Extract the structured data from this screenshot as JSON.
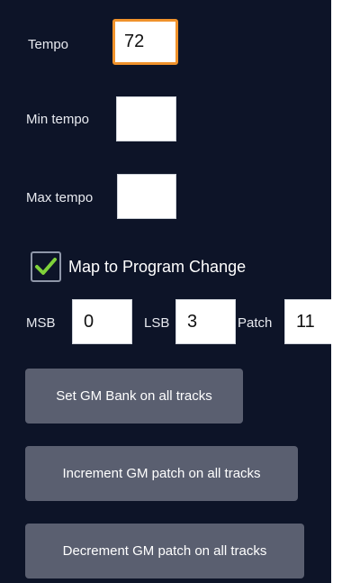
{
  "settings": {
    "tempo": {
      "label": "Tempo",
      "value": "72"
    },
    "min_tempo": {
      "label": "Min tempo",
      "value": ""
    },
    "max_tempo": {
      "label": "Max tempo",
      "value": ""
    },
    "map_program_change": {
      "label": "Map to Program Change",
      "checked": true
    },
    "msb": {
      "label": "MSB",
      "value": "0"
    },
    "lsb": {
      "label": "LSB",
      "value": "3"
    },
    "patch": {
      "label": "Patch",
      "value": "11"
    }
  },
  "actions": {
    "set_gm_bank": "Set GM Bank on all tracks",
    "increment_patch": "Increment GM patch on all tracks",
    "decrement_patch": "Decrement GM patch on all tracks"
  },
  "colors": {
    "background": "#0d1428",
    "button": "#5a5f70",
    "focus_border": "#f0922b",
    "check": "#7fd13a"
  },
  "icons": {
    "checkbox_icon": "checkmark-icon"
  }
}
